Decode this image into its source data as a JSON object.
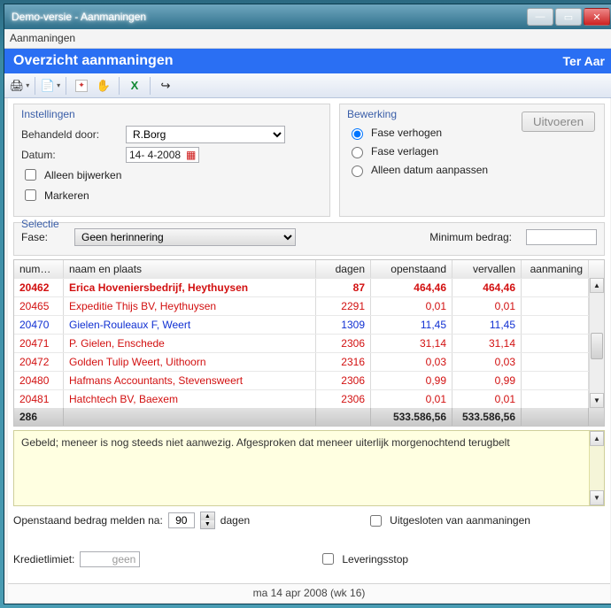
{
  "window": {
    "title": "Demo-versie - Aanmaningen"
  },
  "menubar": {
    "item1": "Aanmaningen"
  },
  "banner": {
    "title": "Overzicht aanmaningen",
    "right": "Ter Aar"
  },
  "toolbar": {
    "print_icon": "printer-icon",
    "print_dd": "▾",
    "pref_icon": "properties-icon",
    "pref_dd": "▾",
    "page_icon": "page-icon",
    "hand_icon": "hand-icon",
    "excel_icon": "excel-icon",
    "exit_icon": "exit-icon"
  },
  "settings": {
    "title": "Instellingen",
    "behandeld_label": "Behandeld door:",
    "behandeld_value": "R.Borg",
    "datum_label": "Datum:",
    "datum_value": "14-  4-2008",
    "alleen_bijwerken": "Alleen bijwerken",
    "markeren": "Markeren"
  },
  "bewerking": {
    "title": "Bewerking",
    "opt1": "Fase verhogen",
    "opt2": "Fase verlagen",
    "opt3": "Alleen datum aanpassen",
    "uitvoeren": "Uitvoeren",
    "selected": "opt1"
  },
  "selectie": {
    "title": "Selectie",
    "fase_label": "Fase:",
    "fase_value": "Geen herinnering",
    "min_label": "Minimum bedrag:",
    "min_value": ""
  },
  "grid": {
    "headers": {
      "nummer": "nummer",
      "naam": "naam en plaats",
      "dagen": "dagen",
      "open": "openstaand",
      "vervallen": "vervallen",
      "aanmaning": "aanmaning"
    },
    "rows": [
      {
        "nummer": "20462",
        "naam": "Erica Hoveniersbedrijf, Heythuysen",
        "dagen": "87",
        "open": "464,46",
        "ver": "464,46",
        "aan": "",
        "style": "red bold"
      },
      {
        "nummer": "20465",
        "naam": "Expeditie Thijs BV, Heythuysen",
        "dagen": "2291",
        "open": "0,01",
        "ver": "0,01",
        "aan": "",
        "style": "red"
      },
      {
        "nummer": "20470",
        "naam": "Gielen-Rouleaux F, Weert",
        "dagen": "1309",
        "open": "11,45",
        "ver": "11,45",
        "aan": "",
        "style": "blue"
      },
      {
        "nummer": "20471",
        "naam": "P. Gielen, Enschede",
        "dagen": "2306",
        "open": "31,14",
        "ver": "31,14",
        "aan": "",
        "style": "red"
      },
      {
        "nummer": "20472",
        "naam": "Golden Tulip Weert, Uithoorn",
        "dagen": "2316",
        "open": "0,03",
        "ver": "0,03",
        "aan": "",
        "style": "red"
      },
      {
        "nummer": "20480",
        "naam": "Hafmans Accountants, Stevensweert",
        "dagen": "2306",
        "open": "0,99",
        "ver": "0,99",
        "aan": "",
        "style": "red"
      },
      {
        "nummer": "20481",
        "naam": "Hatchtech BV, Baexem",
        "dagen": "2306",
        "open": "0,01",
        "ver": "0,01",
        "aan": "",
        "style": "red"
      }
    ],
    "footer": {
      "count": "286",
      "open": "533.586,56",
      "ver": "533.586,56"
    }
  },
  "note": {
    "text": "Gebeld; meneer is nog steeds niet aanwezig. Afgesproken dat meneer uiterlijk morgenochtend terugbelt"
  },
  "bottom": {
    "openstaand_label": "Openstaand bedrag melden na:",
    "openstaand_value": "90",
    "dagen": "dagen",
    "kredietlimiet_label": "Kredietlimiet:",
    "kredietlimiet_value": "geen",
    "uitgesloten": "Uitgesloten van aanmaningen",
    "leveringsstop": "Leveringsstop"
  },
  "status": {
    "text": "ma 14 apr 2008 (wk 16)"
  },
  "winbtns": {
    "min": "—",
    "max": "▭",
    "close": "✕"
  }
}
